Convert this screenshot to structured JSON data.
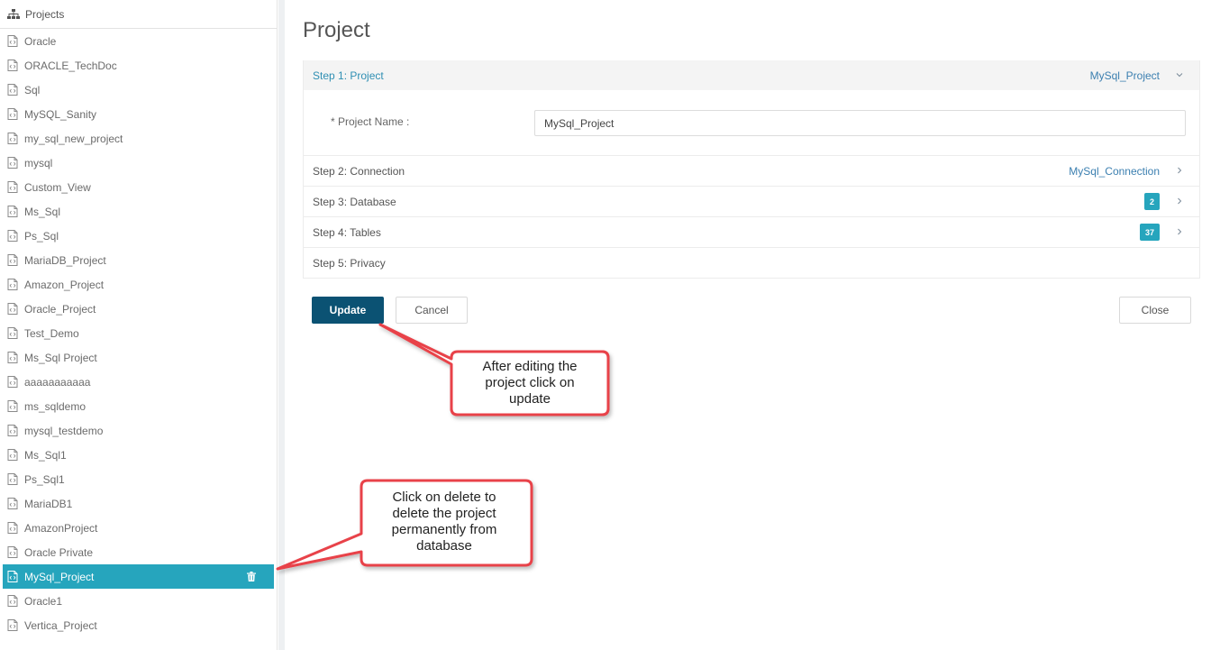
{
  "sidebar": {
    "header_label": "Projects",
    "header_icon": "sitemap-icon",
    "items": [
      {
        "label": "Oracle"
      },
      {
        "label": "ORACLE_TechDoc"
      },
      {
        "label": "Sql"
      },
      {
        "label": "MySQL_Sanity"
      },
      {
        "label": "my_sql_new_project"
      },
      {
        "label": "mysql"
      },
      {
        "label": "Custom_View"
      },
      {
        "label": "Ms_Sql"
      },
      {
        "label": "Ps_Sql"
      },
      {
        "label": "MariaDB_Project"
      },
      {
        "label": "Amazon_Project"
      },
      {
        "label": "Oracle_Project"
      },
      {
        "label": "Test_Demo"
      },
      {
        "label": "Ms_Sql Project"
      },
      {
        "label": "aaaaaaaaaaa"
      },
      {
        "label": "ms_sqldemo"
      },
      {
        "label": "mysql_testdemo"
      },
      {
        "label": "Ms_Sql1"
      },
      {
        "label": "Ps_Sql1"
      },
      {
        "label": "MariaDB1"
      },
      {
        "label": "AmazonProject"
      },
      {
        "label": "Oracle Private"
      },
      {
        "label": "MySql_Project",
        "active": true
      },
      {
        "label": "Oracle1"
      },
      {
        "label": "Vertica_Project"
      }
    ],
    "active_color": "#26a5bd"
  },
  "main": {
    "title": "Project",
    "steps": [
      {
        "label": "Step 1: Project",
        "value": "MySql_Project",
        "expanded": true
      },
      {
        "label": "Step 2: Connection",
        "value": "MySql_Connection"
      },
      {
        "label": "Step 3: Database",
        "badge": "2"
      },
      {
        "label": "Step 4: Tables",
        "badge": "37"
      },
      {
        "label": "Step 5: Privacy"
      }
    ],
    "project_name_label": "* Project Name :",
    "project_name_value": "MySql_Project",
    "buttons": {
      "update": "Update",
      "cancel": "Cancel",
      "close": "Close"
    }
  },
  "callouts": {
    "update_note": "After editing the project click on update",
    "delete_note": "Click on delete to delete the project permanently from database",
    "border_color": "#e8434a"
  },
  "colors": {
    "primary_button": "#0b5273",
    "accent": "#26a5bd",
    "link": "#3b7fb0"
  }
}
